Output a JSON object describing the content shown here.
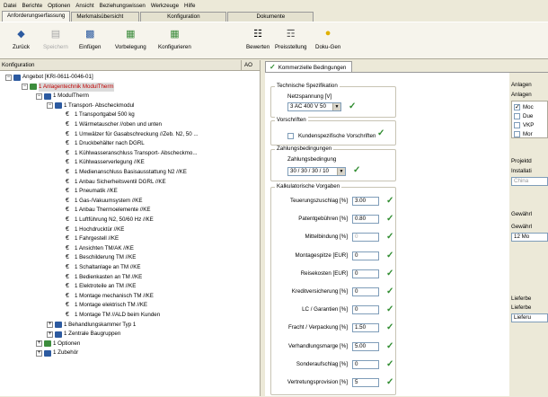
{
  "menu": [
    "Datei",
    "Berichte",
    "Optionen",
    "Ansicht",
    "Beziehungswissen",
    "Werkzeuge",
    "Hilfe"
  ],
  "tabs": [
    "Anforderungserfassung",
    "Merkmalsübersicht",
    "Konfiguration",
    "Dokumente"
  ],
  "toolbar": {
    "back": "Zurück",
    "save": "Speichern",
    "insert": "Einfügen",
    "preset": "Vorbelegung",
    "configure": "Konfigurieren",
    "evaluate": "Bewerten",
    "pricing": "Preisstellung",
    "docgen": "Doku-Gen"
  },
  "left": {
    "header": "Konfiguration",
    "ao": "AO",
    "tree": [
      "Angebot [KRI-0611-0046-01]",
      "1 Anlagentechnik ModulTherm",
      "1 ModulTherm",
      "1 Transport- Abscheckmodul",
      "1 Transportgabel 500 kg",
      "1 Wärmetauscher //oben und unten",
      "1 Umwälzer für Gasabschreckung //Zeb. N2, 50 ...",
      "1 Druckbehälter nach DGRL",
      "1 Kühlwasseranschluss Transport- Abscheckmo...",
      "1 Kühlwasserverlegung //KE",
      "1 Medienanschluss Basisausstattung N2 //KE",
      "1 Anbau Sicherheitsventil DGRL //KE",
      "1 Pneumatik //KE",
      "1 Gas-/Vakuumsystem //KE",
      "1 Anbau Thermoelemente //KE",
      "1 Luftführung N2, 50/60 Hz //KE",
      "1 Hochdrucktür //KE",
      "1 Fahrgestell //KE",
      "1 Ansichten TM/AK //KE",
      "1 Beschilderung TM //KE",
      "1 Schaltanlage an TM //KE",
      "1 Bedienkasten an TM //KE",
      "1 Elektroteile an TM //KE",
      "1 Montage mechanisch TM //KE",
      "1 Montage elektrisch TM //KE",
      "1 Montage TM //ALD beim Kunden",
      "1 Behandlungskammer Typ 1",
      "1 Zentrale Baugruppen",
      "1 Optionen",
      "1 Zubehör"
    ]
  },
  "right": {
    "tab": "Kommerzielle Bedingungen",
    "tech": {
      "title": "Technische Spezifikation",
      "label": "Netzspannung [V]",
      "value": "3 AC 400 V 50"
    },
    "vor": {
      "title": "Vorschriften",
      "label": "Kundenspezifische Vorschriften"
    },
    "zahl": {
      "title": "Zahlungsbedingungen",
      "label": "Zahlungsbedingung",
      "value": "30 / 30 / 30 / 10"
    },
    "kalk": {
      "title": "Kalkulatorische Vorgaben",
      "rows": [
        {
          "label": "Teuerungszuschlag [%]",
          "value": "3.00"
        },
        {
          "label": "Patentgebühren [%]",
          "value": "0.80"
        },
        {
          "label": "Mittelbindung [%]",
          "value": "0"
        },
        {
          "label": "Montagespitze [EUR]",
          "value": "0"
        },
        {
          "label": "Reisekosten [EUR]",
          "value": "0"
        },
        {
          "label": "Kreditversicherung [%]",
          "value": "0"
        },
        {
          "label": "LC / Garantien [%]",
          "value": "0"
        },
        {
          "label": "Fracht / Verpackung [%]",
          "value": "1.50"
        },
        {
          "label": "Verhandlungsmarge [%]",
          "value": "5.00"
        },
        {
          "label": "Sonderaufschlag [%]",
          "value": "0"
        },
        {
          "label": "Vertretungsprovision [%]",
          "value": "5"
        }
      ]
    },
    "far": {
      "anlagen_title": "Anlagen",
      "anlagen_label": "Anlagen",
      "opts": [
        "Moc",
        "Due",
        "VKP",
        "Mor"
      ],
      "projekt_title": "Projektd",
      "install_label": "Installati",
      "install_value": "China",
      "gewahr_title": "Gewährl",
      "gewahr_label": "Gewährl",
      "gewahr_value": "12 Mo",
      "liefer_title": "Lieferbe",
      "liefer_label": "Lieferbe",
      "liefer_value": "Lieferu"
    }
  }
}
